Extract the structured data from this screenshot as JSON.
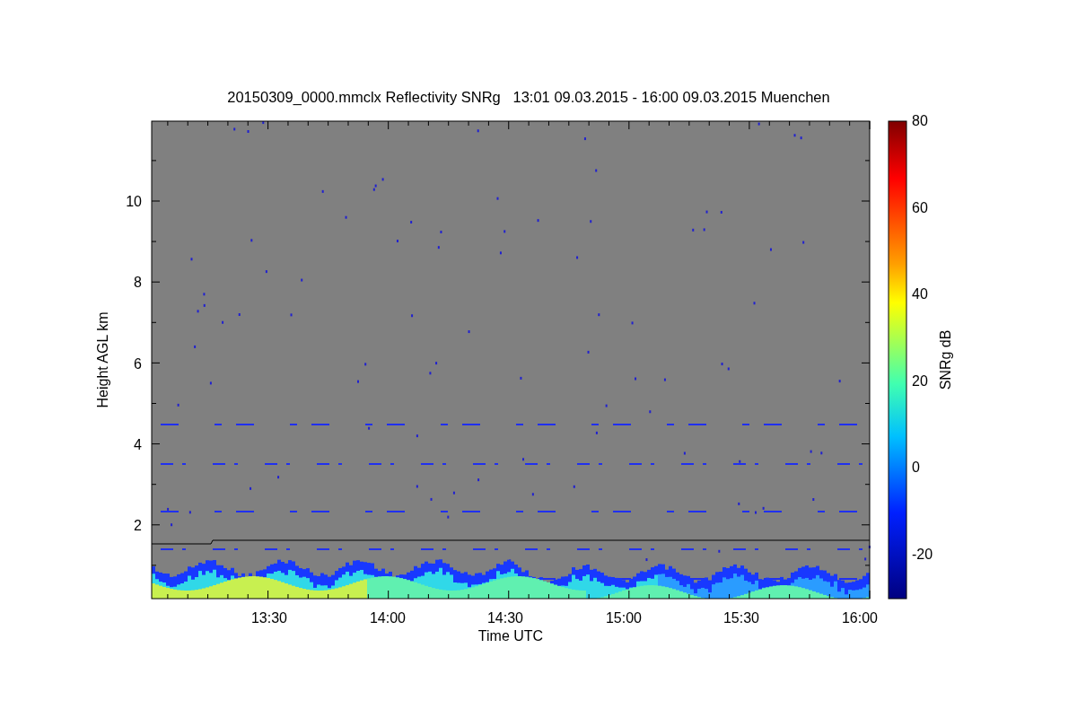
{
  "title": "20150309_0000.mmclx Reflectivity SNRg   13:01 09.03.2015 - 16:00 09.03.2015 Muenchen",
  "y_axis": {
    "label": "Height AGL km",
    "ticks": [
      "10",
      "8",
      "6",
      "4",
      "2"
    ]
  },
  "x_axis": {
    "label": "Time UTC",
    "ticks": [
      "13:30",
      "14:00",
      "14:30",
      "15:00",
      "15:30",
      "16:00"
    ]
  },
  "colorbar": {
    "label": "SNRg dB",
    "ticks": [
      "80",
      "60",
      "40",
      "20",
      "0",
      "-20"
    ]
  }
}
